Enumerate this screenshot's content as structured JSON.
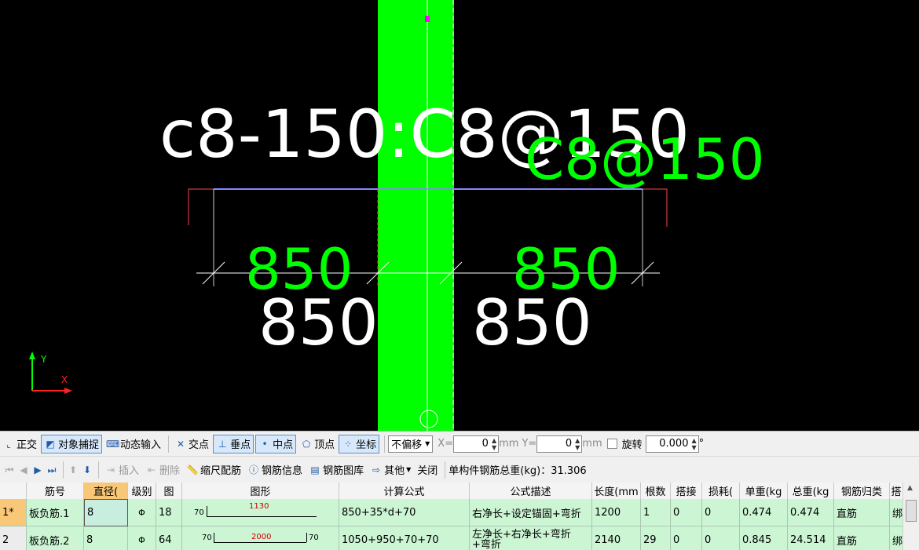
{
  "canvas": {
    "big_label": "c8-150:C8@150",
    "green_label": "C8@150",
    "dim_left_green": "850",
    "dim_right_green": "850",
    "dim_left_white": "850",
    "dim_right_white": "850",
    "axis_y": "Y",
    "axis_x": "X",
    "colors": {
      "background": "#000000",
      "beam": "#00ff00",
      "magenta": "#ff00ff",
      "dim_text_green": "#00ff00",
      "red_line": "#ff3333",
      "rebar_line": "#7a7aff"
    }
  },
  "snapbar": {
    "ortho": "正交",
    "snap": "对象捕捉",
    "dyn_input": "动态输入",
    "intersect": "交点",
    "perp": "垂点",
    "midpoint": "中点",
    "vertex": "顶点",
    "coord": "坐标",
    "offset_mode": "不偏移",
    "x_label": "X=",
    "x_value": "0",
    "mm1": "mm",
    "y_label": "Y=",
    "y_value": "0",
    "mm2": "mm",
    "rotate_label": "旋转",
    "rotate_value": "0.000",
    "degree": "°"
  },
  "actionbar": {
    "insert": "插入",
    "delete": "删除",
    "scale_rebar": "缩尺配筋",
    "rebar_info": "钢筋信息",
    "rebar_library": "钢筋图库",
    "other": "其他",
    "close": "关闭",
    "total_weight_label": "单构件钢筋总重(kg)：31.306"
  },
  "grid": {
    "headers": [
      "",
      "筋号",
      "直径(",
      "级别",
      "图",
      "图形",
      "计算公式",
      "公式描述",
      "长度(mm",
      "根数",
      "搭接",
      "损耗(",
      "单重(kg",
      "总重(kg",
      "钢筋归类",
      "搭"
    ],
    "rows": [
      {
        "idx": "1*",
        "name": "板负筋.1",
        "dia": "8",
        "grade": "Φ",
        "fig": "18",
        "shape_left": "70",
        "shape_mid": "1130",
        "shape_right": "",
        "formula": "850+35*d+70",
        "desc": "右净长+设定锚固+弯折",
        "length": "1200",
        "count": "1",
        "lap": "0",
        "loss": "0",
        "unit_wt": "0.474",
        "total_wt": "0.474",
        "category": "直筋",
        "extra": "绑"
      },
      {
        "idx": "2",
        "name": "板负筋.2",
        "dia": "8",
        "grade": "Φ",
        "fig": "64",
        "shape_left": "70",
        "shape_mid": "2000",
        "shape_right": "70",
        "formula": "1050+950+70+70",
        "desc": "左净长+右净长+弯折+弯折",
        "length": "2140",
        "count": "29",
        "lap": "0",
        "loss": "0",
        "unit_wt": "0.845",
        "total_wt": "24.514",
        "category": "直筋",
        "extra": "绑"
      }
    ]
  }
}
